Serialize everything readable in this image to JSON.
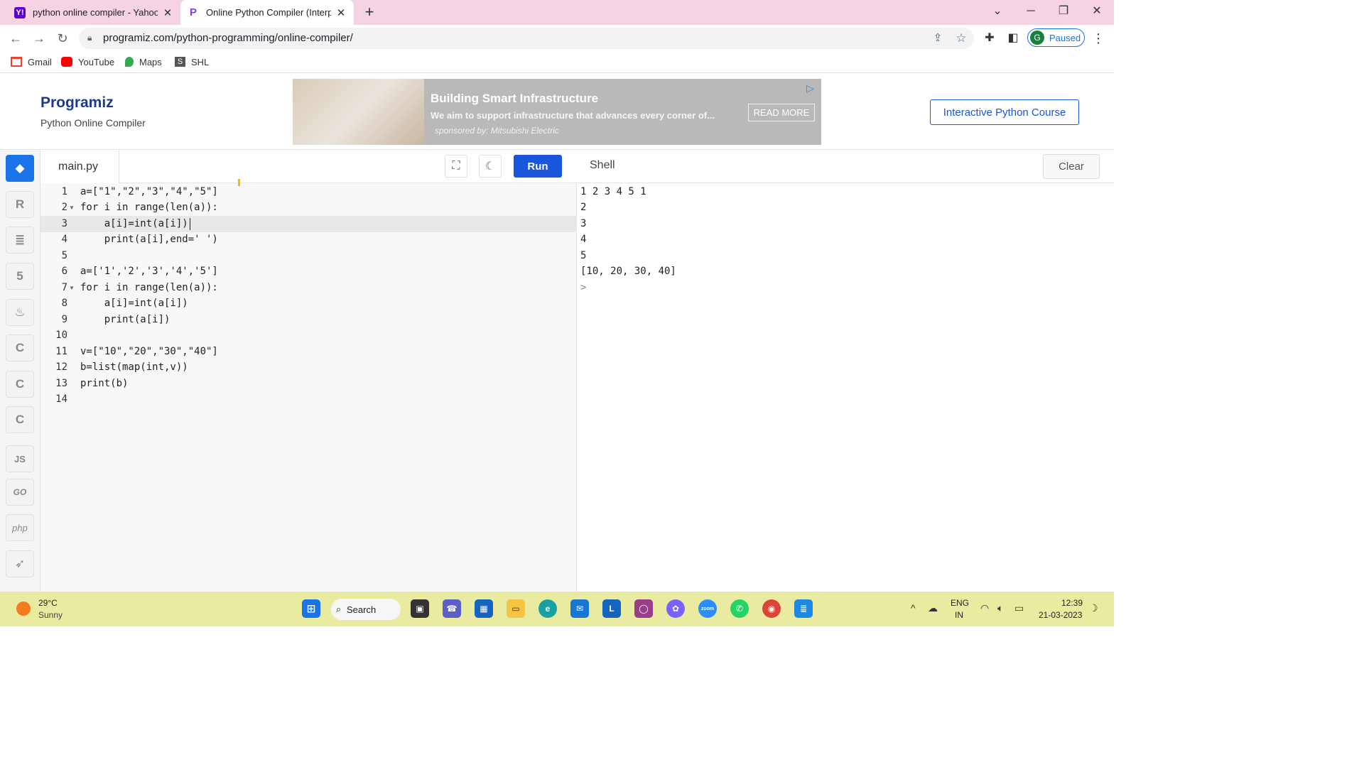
{
  "browser": {
    "tabs": [
      {
        "title": "python online compiler - Yahoo I",
        "favicon": "Y!",
        "favicon_color": "#6001d2"
      },
      {
        "title": "Online Python Compiler (Interpre",
        "favicon": "P",
        "favicon_color": "#ffffff"
      }
    ],
    "url": "programiz.com/python-programming/online-compiler/",
    "profile_initial": "G",
    "profile_status": "Paused",
    "bookmarks": [
      "Gmail",
      "YouTube",
      "Maps",
      "SHL"
    ]
  },
  "header": {
    "logo": "Programiz",
    "subtitle": "Python Online Compiler",
    "course_button": "Interactive Python Course",
    "ad": {
      "title": "Building Smart Infrastructure",
      "description": "We aim to support infrastructure that advances every corner of...",
      "sponsor": "sponsored by: Mitsubishi Electric",
      "button": "READ MORE"
    }
  },
  "sidebar": {
    "languages": [
      "python",
      "r",
      "sql",
      "html",
      "java",
      "c",
      "cpp",
      "csharp",
      "JS",
      "GO",
      "php",
      "swift"
    ]
  },
  "editor": {
    "filename": "main.py",
    "run_label": "Run",
    "lines": [
      {
        "n": "1",
        "code": "a=[\"1\",\"2\",\"3\",\"4\",\"5\"]"
      },
      {
        "n": "2",
        "code": "for i in range(len(a)):"
      },
      {
        "n": "3",
        "code": "    a[i]=int(a[i])"
      },
      {
        "n": "4",
        "code": "    print(a[i],end=' ')"
      },
      {
        "n": "5",
        "code": ""
      },
      {
        "n": "6",
        "code": "a=['1','2','3','4','5']"
      },
      {
        "n": "7",
        "code": "for i in range(len(a)):"
      },
      {
        "n": "8",
        "code": "    a[i]=int(a[i])"
      },
      {
        "n": "9",
        "code": "    print(a[i])"
      },
      {
        "n": "10",
        "code": ""
      },
      {
        "n": "11",
        "code": "v=[\"10\",\"20\",\"30\",\"40\"]"
      },
      {
        "n": "12",
        "code": "b=list(map(int,v))"
      },
      {
        "n": "13",
        "code": "print(b)"
      },
      {
        "n": "14",
        "code": ""
      }
    ]
  },
  "shell": {
    "title": "Shell",
    "clear_label": "Clear",
    "output": [
      "1 2 3 4 5 1",
      "2",
      "3",
      "4",
      "5",
      "[10, 20, 30, 40]",
      ">"
    ]
  },
  "taskbar": {
    "temperature": "29°C",
    "condition": "Sunny",
    "search": "Search",
    "lang_line1": "ENG",
    "lang_line2": "IN",
    "time": "12:39",
    "date": "21-03-2023"
  }
}
